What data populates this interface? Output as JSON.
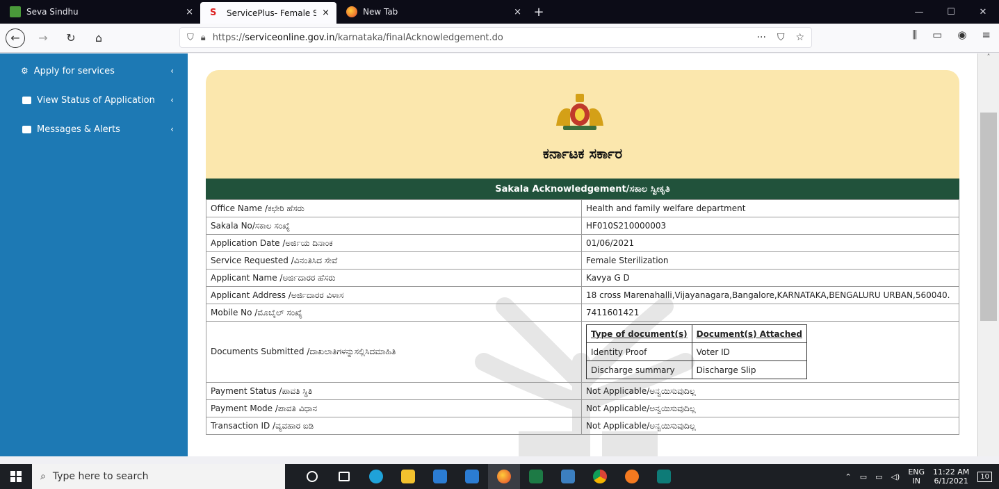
{
  "browser": {
    "tabs": [
      {
        "title": "Seva Sindhu",
        "close": "×"
      },
      {
        "title": "ServicePlus- Female Sterilizatio",
        "close": "×"
      },
      {
        "title": "New Tab",
        "close": "×"
      }
    ],
    "new_tab": "+",
    "url_scheme": "https://",
    "url_host": "serviceonline.gov.in",
    "url_path": "/karnataka/finalAcknowledgement.do",
    "url_more": "···"
  },
  "sidebar": {
    "items": [
      {
        "label": "Apply for services"
      },
      {
        "label": "View Status of Application"
      },
      {
        "label": "Messages & Alerts"
      }
    ]
  },
  "header": {
    "gov_title": "ಕರ್ನಾಟಕ ಸರ್ಕಾರ",
    "ack_title": "Sakala Acknowledgement/ಸಕಾಲ ಸ್ವೀಕೃತಿ"
  },
  "rows": [
    {
      "label": "Office Name /ಕಛೇರಿ ಹೆಸರು",
      "value": "Health and family welfare department"
    },
    {
      "label": "Sakala No/ಸಕಾಲ ಸಂಖ್ಯೆ",
      "value": "HF010S210000003"
    },
    {
      "label": "Application Date /ಅರ್ಜಿಯ ದಿನಾಂಕ",
      "value": "01/06/2021"
    },
    {
      "label": "Service Requested /ವಿನಂತಿಸಿದ ಸೇವೆ",
      "value": "Female Sterilization"
    },
    {
      "label": "Applicant Name /ಅರ್ಜಿದಾರರ ಹೆಸರು",
      "value": "Kavya G D"
    },
    {
      "label": "Applicant Address /ಅರ್ಜಿದಾರರ ವಿಳಾಸ",
      "value": "18 cross Marenahalli,Vijayanagara,Bangalore,KARNATAKA,BENGALURU URBAN,560040."
    },
    {
      "label": "Mobile No /ಮೊಬೈಲ್ ಸಂಖ್ಯೆ",
      "value": "7411601421"
    }
  ],
  "documents": {
    "label": "Documents Submitted /ದಾಖಲಾತಿಗಳನ್ನುಸಲ್ಲಿಸಿದಮಾಹಿತಿ",
    "col_type": "Type of document(s)",
    "col_attached": "Document(s) Attached",
    "items": [
      {
        "type": "Identity Proof",
        "attached": "Voter ID"
      },
      {
        "type": "Discharge summary",
        "attached": "Discharge Slip"
      }
    ]
  },
  "rows2": [
    {
      "label": "Payment Status /ಪಾವತಿ ಸ್ಥಿತಿ",
      "value": "Not Applicable/ಅನ್ವಯಿಸುವುದಿಲ್ಲ"
    },
    {
      "label": "Payment Mode /ಪಾವತಿ ವಿಧಾನ",
      "value": "Not Applicable/ಅನ್ವಯಿಸುವುದಿಲ್ಲ"
    },
    {
      "label": "Transaction ID /ವ್ಯವಹಾರ ಐಡಿ",
      "value": "Not Applicable/ಅನ್ವಯಿಸುವುದಿಲ್ಲ"
    }
  ],
  "taskbar": {
    "search_placeholder": "Type here to search",
    "lang_top": "ENG",
    "lang_bottom": "IN",
    "time": "11:22 AM",
    "date": "6/1/2021",
    "notif_count": "10"
  }
}
